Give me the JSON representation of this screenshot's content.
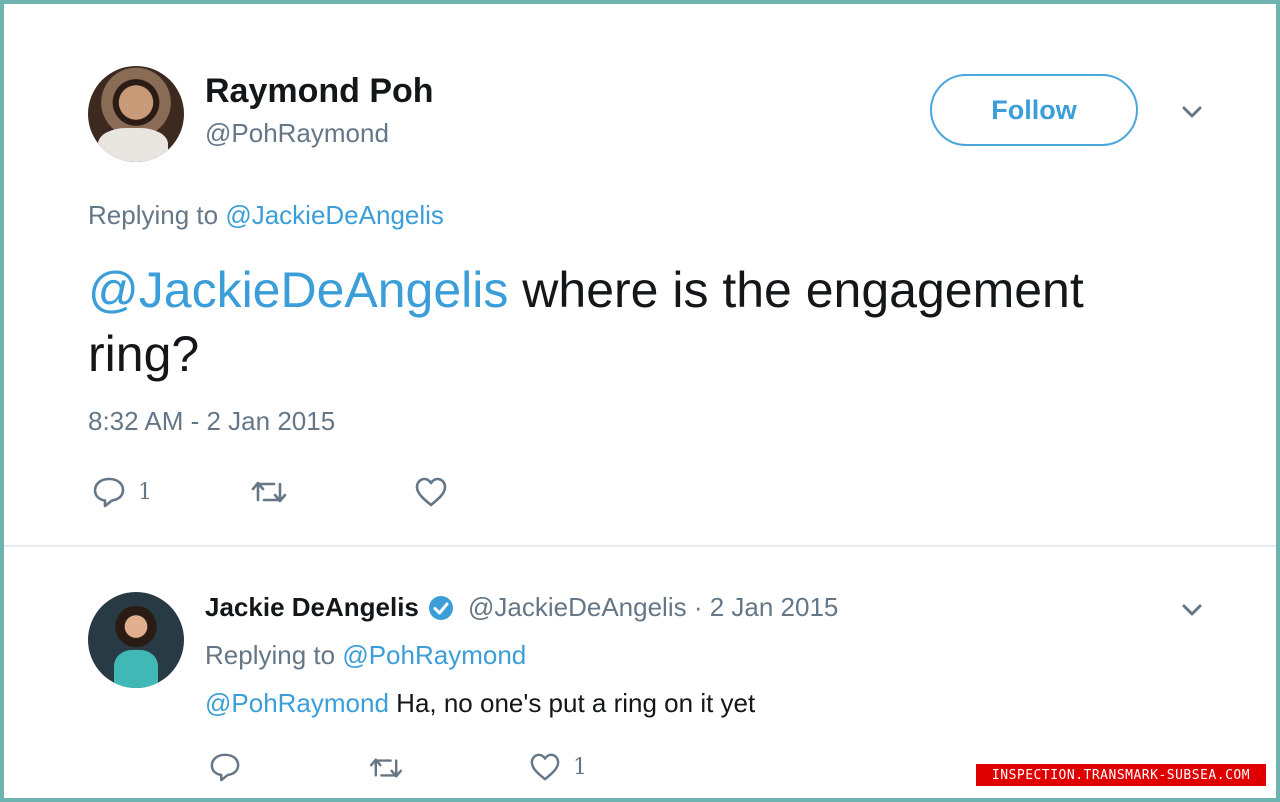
{
  "tweet": {
    "author": {
      "name": "Raymond Poh",
      "handle": "@PohRaymond"
    },
    "follow_label": "Follow",
    "replying_prefix": "Replying to",
    "replying_to": "@JackieDeAngelis",
    "mention": "@JackieDeAngelis",
    "text": " where is the engagement ring?",
    "timestamp": "8:32 AM - 2 Jan 2015",
    "actions": {
      "reply_count": "1",
      "retweet_count": "",
      "like_count": ""
    }
  },
  "reply": {
    "author": {
      "name": "Jackie DeAngelis",
      "verified": true
    },
    "meta": "@JackieDeAngelis · 2 Jan 2015",
    "replying_prefix": "Replying to",
    "replying_to": "@PohRaymond",
    "mention": "@PohRaymond",
    "text": " Ha, no one's put a ring on it yet",
    "actions": {
      "reply_count": "",
      "retweet_count": "",
      "like_count": "1"
    }
  },
  "watermark": "INSPECTION.TRANSMARK-SUBSEA.COM",
  "colors": {
    "link": "#3b9ed8",
    "frame": "#6fb3b1",
    "muted": "#657786",
    "watermark_bg": "#e00000"
  },
  "icons": [
    "reply-icon",
    "retweet-icon",
    "heart-icon",
    "chevron-down-icon",
    "verified-badge-icon"
  ]
}
